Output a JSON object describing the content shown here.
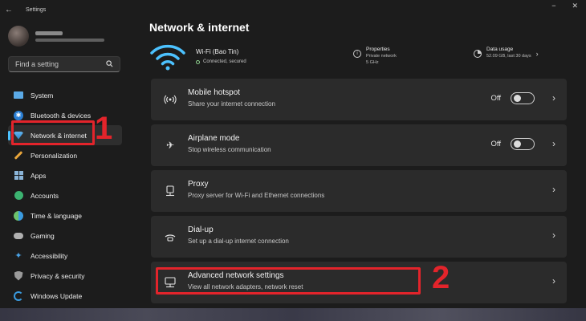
{
  "window": {
    "title": "Settings",
    "back_glyph": "←",
    "minimize_glyph": "−",
    "close_glyph": "✕"
  },
  "sidebar": {
    "search_placeholder": "Find a setting",
    "items": [
      {
        "label": "System",
        "icon": "system-icon"
      },
      {
        "label": "Bluetooth & devices",
        "icon": "bluetooth-icon"
      },
      {
        "label": "Network & internet",
        "icon": "network-icon",
        "selected": true
      },
      {
        "label": "Personalization",
        "icon": "pen-icon"
      },
      {
        "label": "Apps",
        "icon": "apps-icon"
      },
      {
        "label": "Accounts",
        "icon": "account-icon"
      },
      {
        "label": "Time & language",
        "icon": "globe-icon"
      },
      {
        "label": "Gaming",
        "icon": "controller-icon"
      },
      {
        "label": "Accessibility",
        "icon": "accessibility-icon"
      },
      {
        "label": "Privacy & security",
        "icon": "shield-icon"
      },
      {
        "label": "Windows Update",
        "icon": "update-icon"
      }
    ]
  },
  "main": {
    "title": "Network & internet",
    "wifi": {
      "name": "Wi-Fi (Bao Tin)",
      "status": "Connected, secured"
    },
    "properties": {
      "title": "Properties",
      "line1": "Private network",
      "line2": "5 GHz"
    },
    "data_usage": {
      "title": "Data usage",
      "value": "52.09 GB, last 30 days"
    },
    "cards": [
      {
        "title": "Mobile hotspot",
        "subtitle": "Share your internet connection",
        "icon": "hotspot-icon",
        "toggle_label": "Off"
      },
      {
        "title": "Airplane mode",
        "subtitle": "Stop wireless communication",
        "icon": "airplane-icon",
        "toggle_label": "Off"
      },
      {
        "title": "Proxy",
        "subtitle": "Proxy server for Wi-Fi and Ethernet connections",
        "icon": "proxy-icon"
      },
      {
        "title": "Dial-up",
        "subtitle": "Set up a dial-up internet connection",
        "icon": "dialup-icon"
      },
      {
        "title": "Advanced network settings",
        "subtitle": "View all network adapters, network reset",
        "icon": "advanced-network-icon"
      }
    ]
  },
  "annotations": {
    "num1": "1",
    "num2": "2",
    "color": "#e3242b"
  },
  "colors": {
    "background": "#1c1c1c",
    "card": "#2b2b2b",
    "accent": "#4cc2ff"
  }
}
